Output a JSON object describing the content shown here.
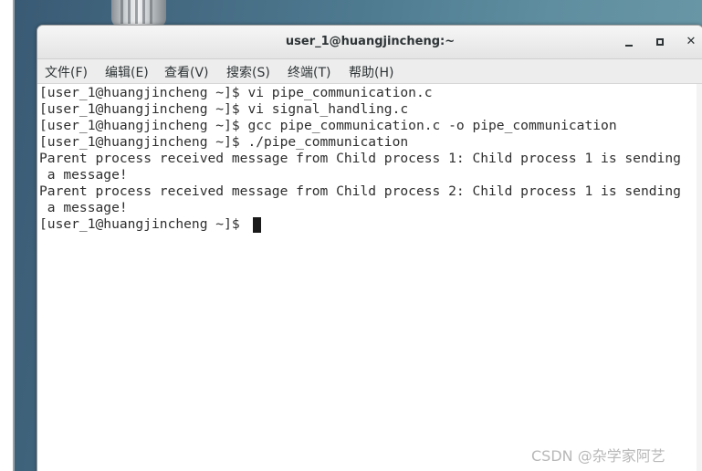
{
  "window": {
    "title": "user_1@huangjincheng:~",
    "close_glyph": "✕"
  },
  "menu": {
    "items": [
      "文件(F)",
      "编辑(E)",
      "查看(V)",
      "搜索(S)",
      "终端(T)",
      "帮助(H)"
    ]
  },
  "terminal": {
    "lines": [
      "[user_1@huangjincheng ~]$ vi pipe_communication.c",
      "[user_1@huangjincheng ~]$ vi signal_handling.c",
      "[user_1@huangjincheng ~]$ gcc pipe_communication.c -o pipe_communication",
      "[user_1@huangjincheng ~]$ ./pipe_communication",
      "Parent process received message from Child process 1: Child process 1 is sending",
      " a message!",
      "Parent process received message from Child process 2: Child process 1 is sending",
      " a message!",
      "[user_1@huangjincheng ~]$ "
    ]
  },
  "watermark": {
    "text": "CSDN @杂学家阿艺"
  },
  "icons": {
    "minimize": "minimize-icon",
    "maximize": "maximize-icon",
    "close": "close-icon"
  }
}
